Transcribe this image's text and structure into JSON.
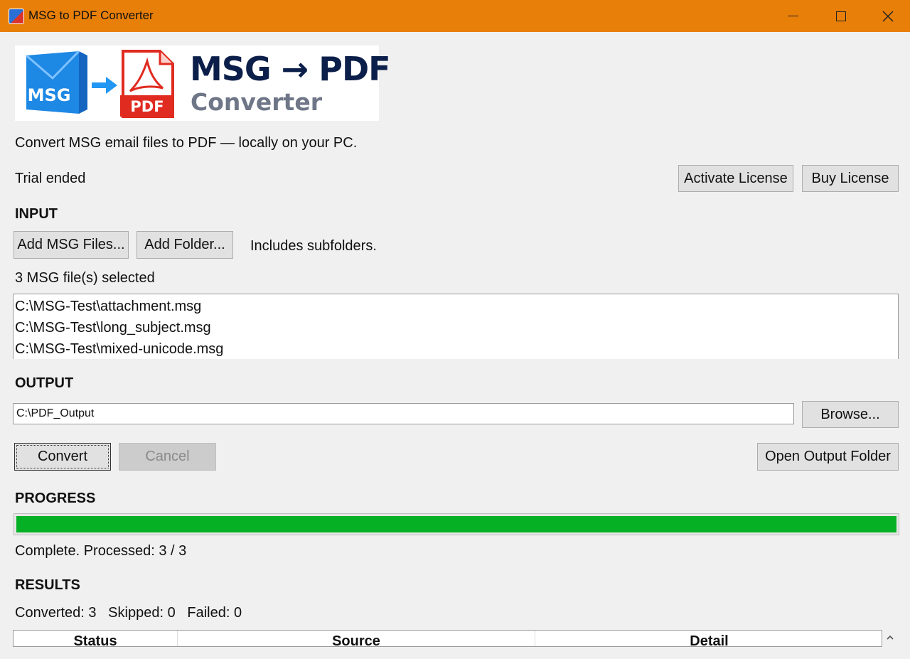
{
  "window": {
    "title": "MSG to PDF Converter"
  },
  "logo": {
    "msg_text": "MSG",
    "pdf_text": "PDF",
    "title": "MSG → PDF",
    "subtitle": "Converter"
  },
  "tagline": "Convert MSG email files to PDF — locally on your PC.",
  "license": {
    "status": "Trial ended",
    "activate_label": "Activate License",
    "buy_label": "Buy License"
  },
  "input": {
    "heading": "INPUT",
    "add_files_label": "Add MSG Files...",
    "add_folder_label": "Add Folder...",
    "hint": "Includes subfolders.",
    "selected_count": "3 MSG file(s) selected",
    "files": [
      "C:\\MSG-Test\\attachment.msg",
      "C:\\MSG-Test\\long_subject.msg",
      "C:\\MSG-Test\\mixed-unicode.msg"
    ]
  },
  "output": {
    "heading": "OUTPUT",
    "path": "C:\\PDF_Output",
    "browse_label": "Browse..."
  },
  "actions": {
    "convert_label": "Convert",
    "cancel_label": "Cancel",
    "open_output_label": "Open Output Folder"
  },
  "progress": {
    "heading": "PROGRESS",
    "fraction": 1.0,
    "status": "Complete. Processed: 3 / 3",
    "color": "#06b025"
  },
  "results": {
    "heading": "RESULTS",
    "summary": "Converted: 3   Skipped: 0   Failed: 0",
    "columns": [
      "Status",
      "Source",
      "Detail"
    ]
  },
  "colors": {
    "titlebar": "#e87f09",
    "window_bg": "#f0f0f0"
  }
}
